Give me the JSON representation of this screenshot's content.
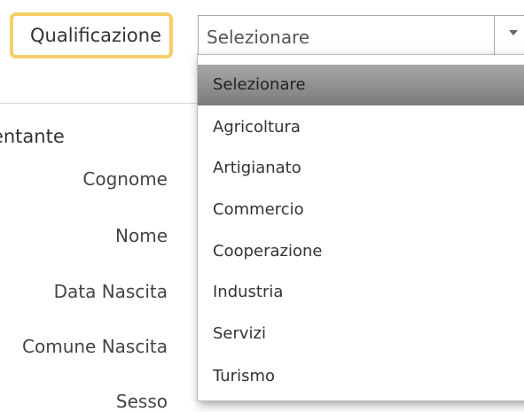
{
  "field": {
    "label": "Qualificazione",
    "selected_value": "Selezionare"
  },
  "section": {
    "title": "sentante"
  },
  "form_labels": {
    "cognome": "Cognome",
    "nome": "Nome",
    "data_nascita": "Data Nascita",
    "comune_nascita": "Comune Nascita",
    "sesso": "Sesso"
  },
  "dropdown": {
    "options": [
      "Selezionare",
      "Agricoltura",
      "Artigianato",
      "Commercio",
      "Cooperazione",
      "Industria",
      "Servizi",
      "Turismo"
    ],
    "selected_index": 0
  },
  "colors": {
    "highlight_border": "#f6cf6a",
    "selected_option_top": "#a7a7a7",
    "selected_option_bottom": "#7b7b7b"
  }
}
